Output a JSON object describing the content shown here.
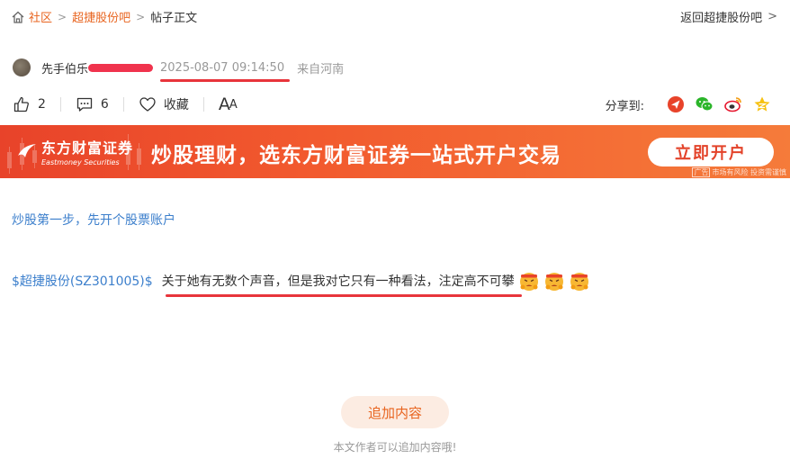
{
  "breadcrumb": {
    "items": [
      "社区",
      "超捷股份吧",
      "帖子正文"
    ],
    "separator": ">",
    "back_label": "返回超捷股份吧",
    "back_chevron": ">"
  },
  "author": {
    "name": "先手伯乐",
    "time": "2025-08-07 09:14:50",
    "location": "来自河南"
  },
  "actions": {
    "like_count": "2",
    "comment_count": "6",
    "favorite_label": "收藏",
    "font_big": "A",
    "font_small": "A",
    "share_label": "分享到:"
  },
  "banner": {
    "brand_cn": "东方财富证券",
    "brand_en": "Eastmoney Securities",
    "slogan": "炒股理财，选东方财富证券一站式开户交易",
    "cta": "立即开户",
    "ad_tag": "广告",
    "risk_note": "市场有风险 投资需谨慎",
    "color": "#ee4e2c"
  },
  "post": {
    "link_text": "炒股第一步，先开个股票账户",
    "stock_tag": "$超捷股份(SZ301005)$",
    "text": "关于她有无数个声音，但是我对它只有一种看法，注定高不可攀"
  },
  "footer": {
    "add_button": "追加内容",
    "add_note": "本文作者可以追加内容哦!"
  },
  "colors": {
    "accent": "#e8641f",
    "link": "#3c7fcc",
    "redline": "#e8343b"
  }
}
